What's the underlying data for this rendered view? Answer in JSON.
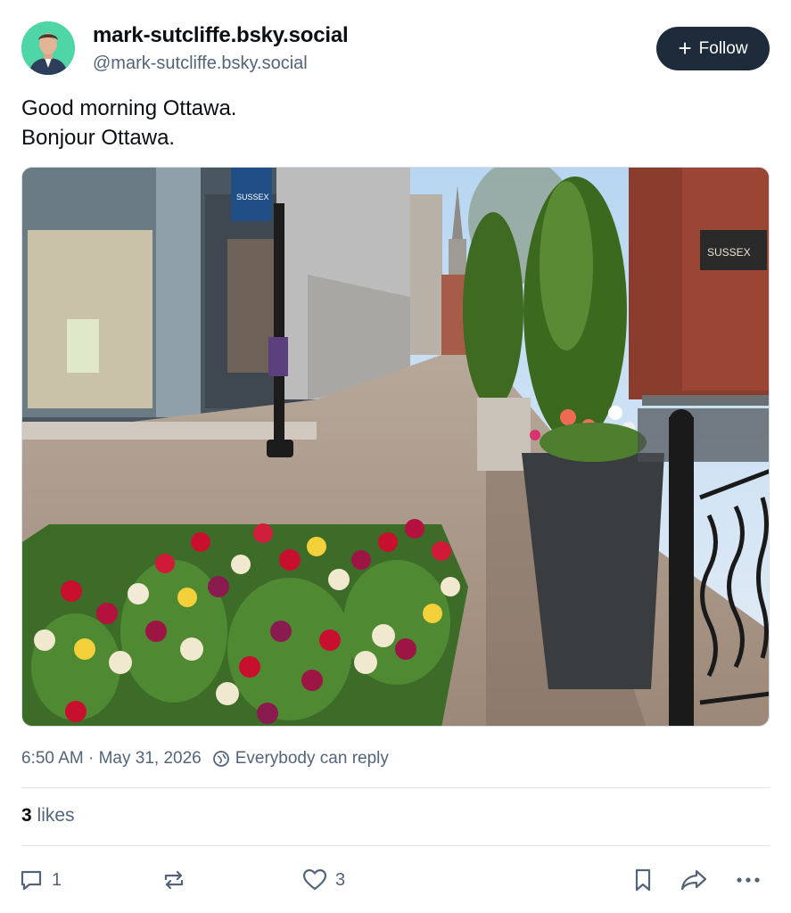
{
  "author": {
    "display_name": "mark-sutcliffe.bsky.social",
    "handle": "@mark-sutcliffe.bsky.social",
    "avatar_icon": "profile-photo"
  },
  "follow_button": {
    "label": "Follow",
    "icon": "plus-icon"
  },
  "post": {
    "lines": [
      "Good morning Ottawa.",
      "Bonjour Ottawa."
    ]
  },
  "image": {
    "sign_left": "SUSSEX",
    "sign_right": "SUSSEX"
  },
  "meta": {
    "timestamp": "6:50 AM · May 31, 2026",
    "reply_setting": "Everybody can reply",
    "reply_icon": "globe-icon"
  },
  "stats": {
    "likes_count": "3",
    "likes_label": "likes"
  },
  "actions": {
    "reply_count": "1",
    "repost_count": "",
    "like_count": "3"
  },
  "colors": {
    "follow_bg": "#1e2b3b",
    "muted_text": "#53647a",
    "avatar_bg": "#4fd6a6"
  }
}
